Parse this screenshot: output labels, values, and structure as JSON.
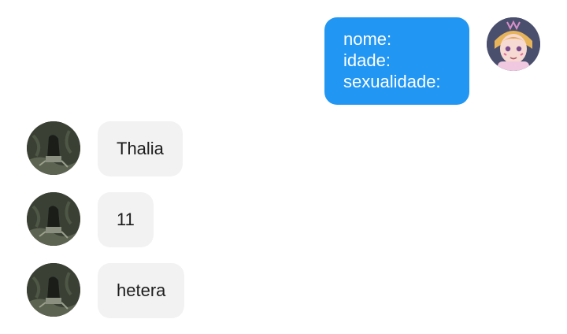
{
  "chat": {
    "sent_message": {
      "lines": [
        "nome:",
        "idade:",
        "sexualidade:"
      ],
      "avatar_icon": "anime-character-avatar",
      "bubble_color": "#2196f3",
      "text_color": "#ffffff"
    },
    "received_messages": [
      {
        "text": "Thalia",
        "avatar_icon": "dark-photo-avatar"
      },
      {
        "text": "11",
        "avatar_icon": "dark-photo-avatar"
      },
      {
        "text": "hetera",
        "avatar_icon": "dark-photo-avatar"
      }
    ],
    "received_bubble_color": "#f2f2f2",
    "received_text_color": "#1c1c1c",
    "background_color": "#ffffff"
  }
}
